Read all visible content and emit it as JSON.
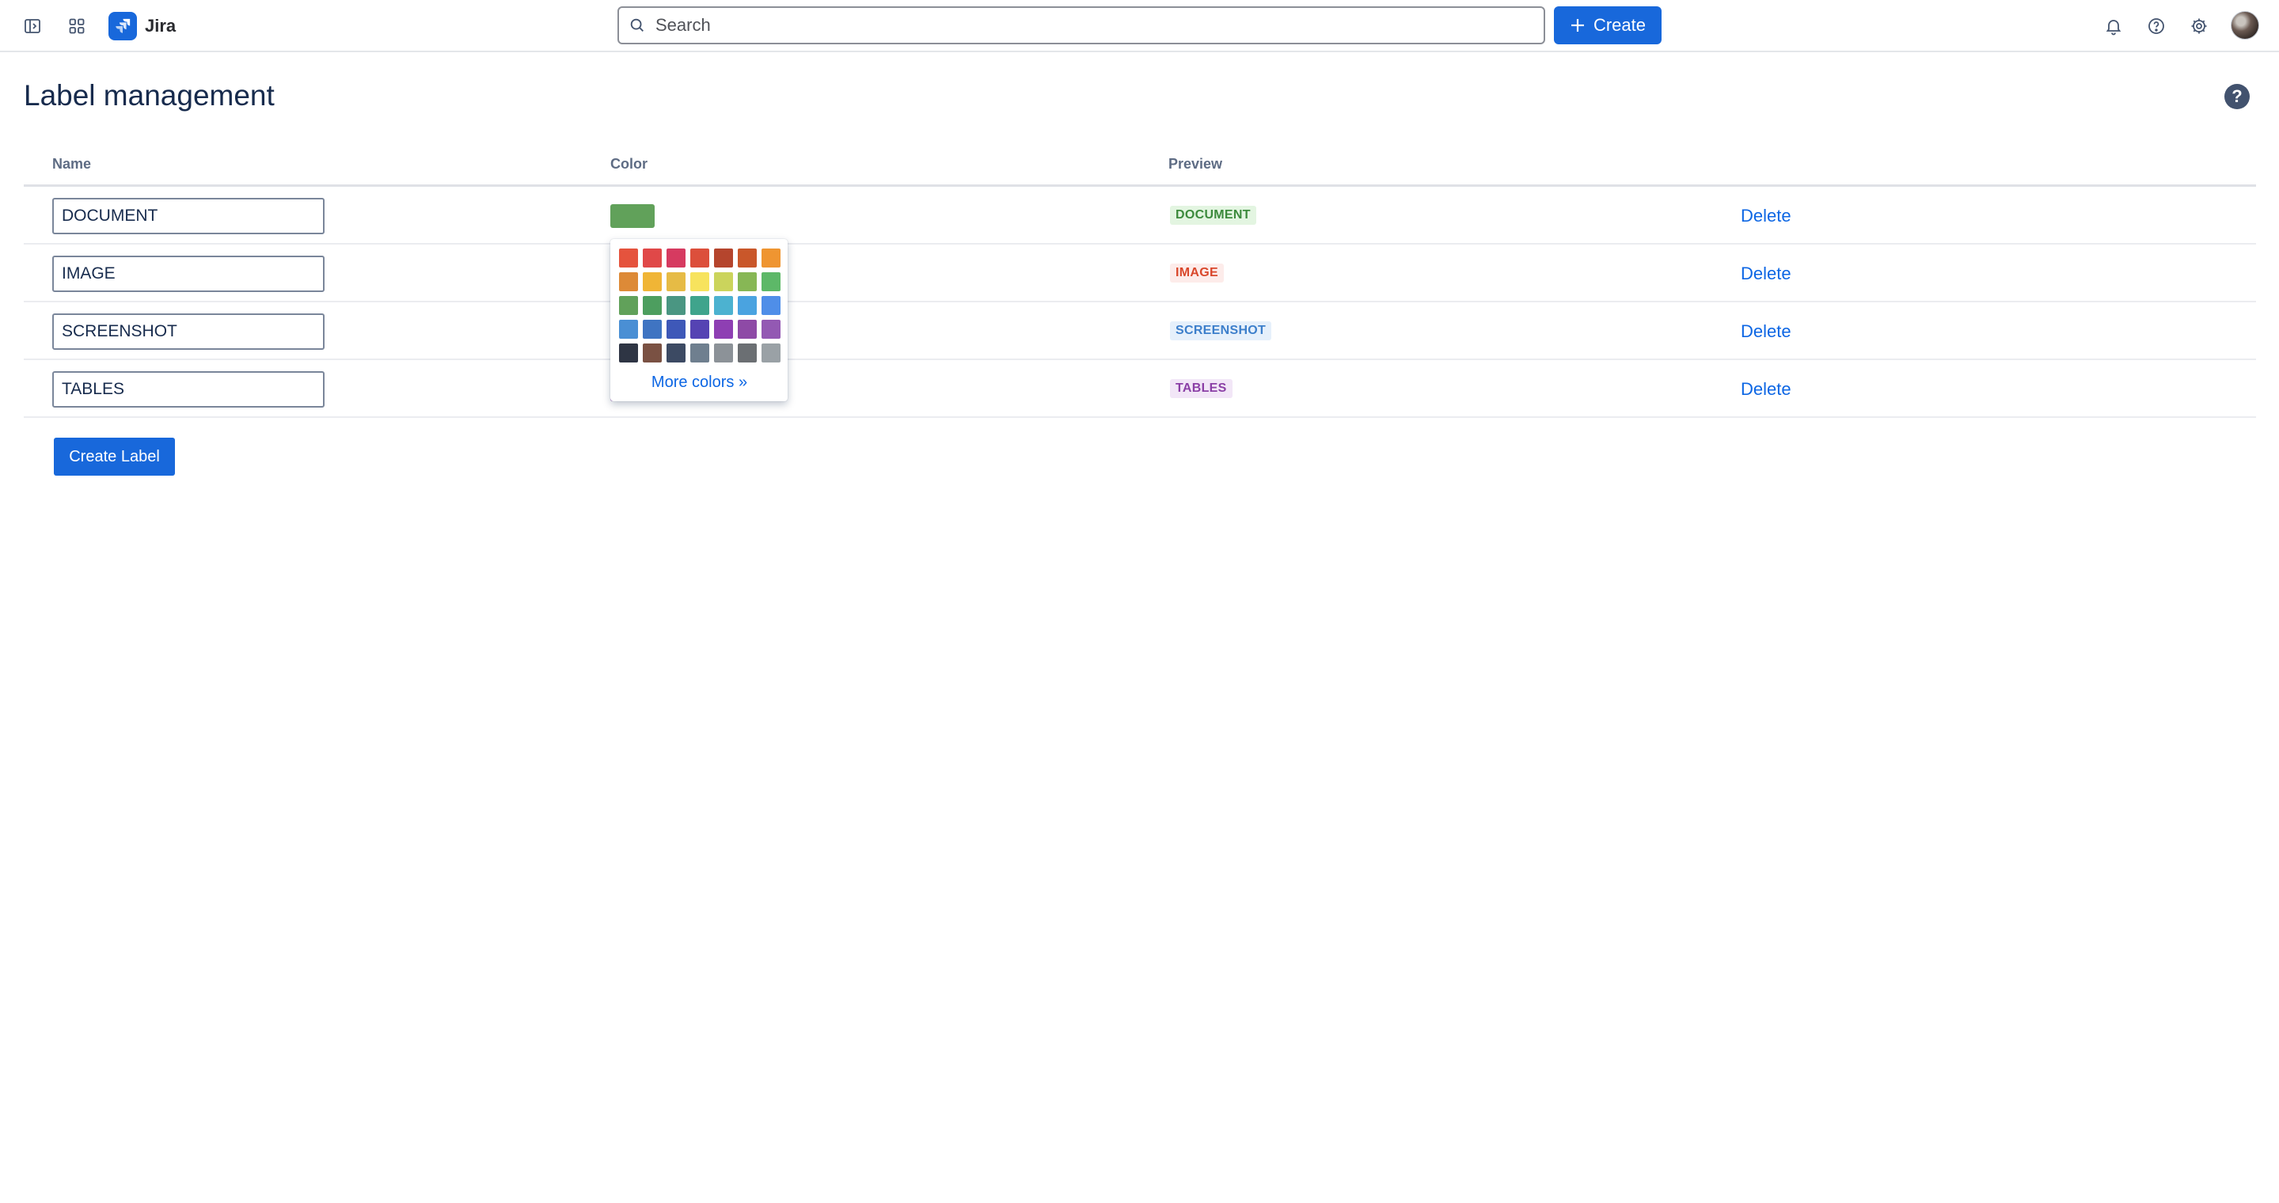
{
  "app": {
    "name": "Jira",
    "brand_color": "#1868db"
  },
  "topnav": {
    "sidebar_toggle_icon": "sidebar-toggle-icon",
    "app_switcher_icon": "app-switcher-icon",
    "search_placeholder": "Search",
    "create_label": "Create",
    "notifications_icon": "bell-icon",
    "help_icon": "help-icon",
    "settings_icon": "gear-icon"
  },
  "page": {
    "title": "Label management",
    "help_icon": "?"
  },
  "table": {
    "columns": {
      "name": "Name",
      "color": "Color",
      "preview": "Preview"
    },
    "rows": [
      {
        "name": "DOCUMENT",
        "color": "#61a15a",
        "preview": "DOCUMENT",
        "preview_fg": "#3c8a3c",
        "preview_bg": "#e3f5e1",
        "action": "Delete"
      },
      {
        "name": "IMAGE",
        "color": "#e5533d",
        "preview": "IMAGE",
        "preview_fg": "#d9472b",
        "preview_bg": "#fdecea",
        "action": "Delete"
      },
      {
        "name": "SCREENSHOT",
        "color": "#4a90d9",
        "preview": "SCREENSHOT",
        "preview_fg": "#3d7fcb",
        "preview_bg": "#e6f0fb",
        "action": "Delete"
      },
      {
        "name": "TABLES",
        "color": "#8e44ad",
        "preview": "TABLES",
        "preview_fg": "#8b3fa6",
        "preview_bg": "#f2e6f7",
        "action": "Delete"
      }
    ]
  },
  "create_label_button": "Create Label",
  "color_picker": {
    "more_colors": "More colors »",
    "colors": [
      "#e5533d",
      "#e04848",
      "#d63a60",
      "#dc4f3b",
      "#b5452d",
      "#c9572a",
      "#ef9531",
      "#dd8a37",
      "#f0b536",
      "#e6bb45",
      "#f7e35d",
      "#cbd45c",
      "#87b755",
      "#5db868",
      "#61a15a",
      "#4d9e5f",
      "#4a9682",
      "#3fa48c",
      "#4cb2d0",
      "#4aa3e0",
      "#4f8ee8",
      "#4a8fd4",
      "#3f74c2",
      "#3e58b8",
      "#5543b3",
      "#8e3fb3",
      "#8e4aa6",
      "#9359b3",
      "#2e3544",
      "#7a5143",
      "#3c4a63",
      "#6f7f8f",
      "#8c9298",
      "#6b6f73",
      "#9aa1a6"
    ]
  }
}
